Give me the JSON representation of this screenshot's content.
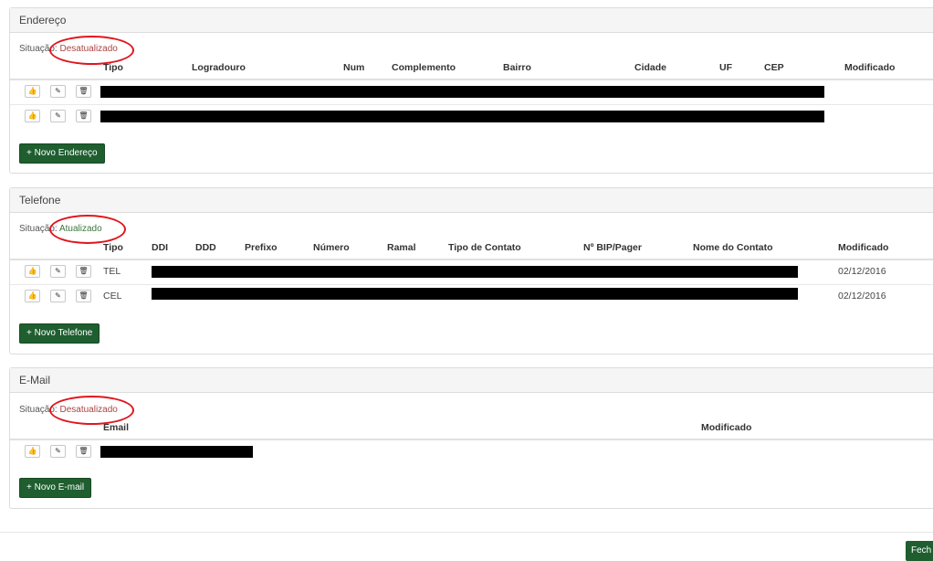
{
  "situacao_label": "Situação:",
  "endereco": {
    "title": "Endereço",
    "status": "Desatualizado",
    "columns": [
      "Tipo",
      "Logradouro",
      "Num",
      "Complemento",
      "Bairro",
      "Cidade",
      "UF",
      "CEP",
      "Modificado"
    ],
    "new_button": "+ Novo Endereço"
  },
  "telefone": {
    "title": "Telefone",
    "status": "Atualizado",
    "columns": [
      "Tipo",
      "DDI",
      "DDD",
      "Prefixo",
      "Número",
      "Ramal",
      "Tipo de Contato",
      "Nº BIP/Pager",
      "Nome do Contato",
      "Modificado"
    ],
    "rows": [
      {
        "tipo": "TEL",
        "modificado": "02/12/2016"
      },
      {
        "tipo": "CEL",
        "modificado": "02/12/2016"
      }
    ],
    "new_button": "+ Novo Telefone"
  },
  "email": {
    "title": "E-Mail",
    "status": "Desatualizado",
    "columns": [
      "Email",
      "Modificado"
    ],
    "new_button": "+ Novo E-mail"
  },
  "icons": [
    "thumbs-up-icon",
    "pencil-icon",
    "trash-icon"
  ],
  "footer": {
    "close_button": "Fech"
  },
  "colors": {
    "accent_green": "#1e5e2f",
    "status_bad": "#a94442",
    "status_ok": "#3c763d",
    "highlight_circle": "#e0161d"
  }
}
